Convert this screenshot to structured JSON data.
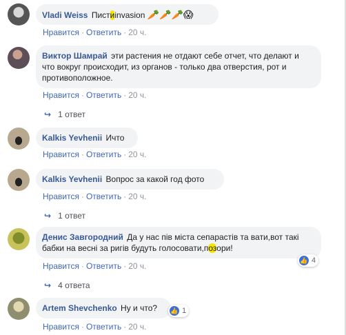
{
  "actions": {
    "like": "Нравится",
    "reply": "Ответить",
    "time": "20 ч."
  },
  "comments": [
    {
      "author": "Vladi Weiss",
      "text_a": "Пист",
      "text_hidden": "и",
      "text_b": "invasion",
      "emojis": "🥕🥕🥕😱"
    },
    {
      "author": "Виктор Шамрай",
      "text": "эти растения не отдают себе отчет, что делают и что вокруг происходит, из органов - только два отверстия, рот и противоположное.",
      "replies": "1 ответ"
    },
    {
      "author": "Kalkis Yevhenii",
      "text": "Ичто"
    },
    {
      "author": "Kalkis Yevhenii",
      "text": "Вопрос за какой год фото",
      "replies": "1 ответ"
    },
    {
      "author": "Денис Завгородний",
      "text_a": "Да у нас пів міста сепарастів та вати,вот такі бабки на весні за ригів будуть голосовати,п",
      "text_hidden": "оз",
      "text_b": "ори!",
      "reaction_count": "4",
      "replies": "4 ответа"
    },
    {
      "author": "Artem Shevchenko",
      "text": "Ну и что?",
      "reaction_count": "1"
    }
  ],
  "colors": {
    "author": "#385898",
    "link": "#4267b2",
    "bubble": "#f2f3f5",
    "meta": "#90949c",
    "highlight": "#f7e500"
  }
}
